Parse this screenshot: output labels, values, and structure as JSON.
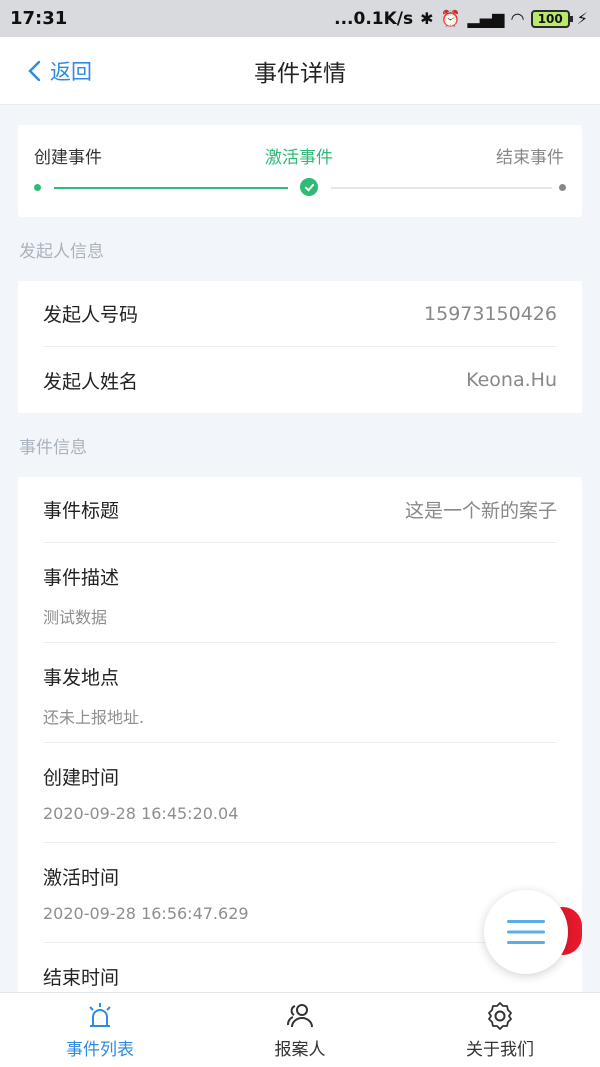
{
  "status_bar": {
    "time": "17:31",
    "network_speed": "...0.1K/s",
    "battery": "100",
    "icons": [
      "bluetooth-icon",
      "alarm-icon",
      "signal-hd-icon",
      "wifi-icon",
      "battery-icon",
      "charging-icon"
    ]
  },
  "header": {
    "back_label": "返回",
    "title": "事件详情"
  },
  "progress": {
    "steps": [
      "创建事件",
      "激活事件",
      "结束事件"
    ],
    "active_index": 1
  },
  "sections": {
    "initiator_label": "发起人信息",
    "event_label": "事件信息"
  },
  "initiator": {
    "phone_label": "发起人号码",
    "phone_value": "15973150426",
    "name_label": "发起人姓名",
    "name_value": "Keona.Hu"
  },
  "event": {
    "title_label": "事件标题",
    "title_value": "这是一个新的案子",
    "desc_label": "事件描述",
    "desc_value": "测试数据",
    "location_label": "事发地点",
    "location_value": "还未上报地址.",
    "created_label": "创建时间",
    "created_value": "2020-09-28 16:45:20.04",
    "activated_label": "激活时间",
    "activated_value": "2020-09-28 16:56:47.629",
    "ended_label": "结束时间"
  },
  "tabs": [
    {
      "label": "事件列表",
      "icon": "alarm-light-icon",
      "active": true
    },
    {
      "label": "报案人",
      "icon": "people-icon",
      "active": false
    },
    {
      "label": "关于我们",
      "icon": "gear-icon",
      "active": false
    }
  ],
  "colors": {
    "accent_blue": "#2e8be0",
    "accent_green": "#2dbb76",
    "fab_red": "#e8192c"
  }
}
